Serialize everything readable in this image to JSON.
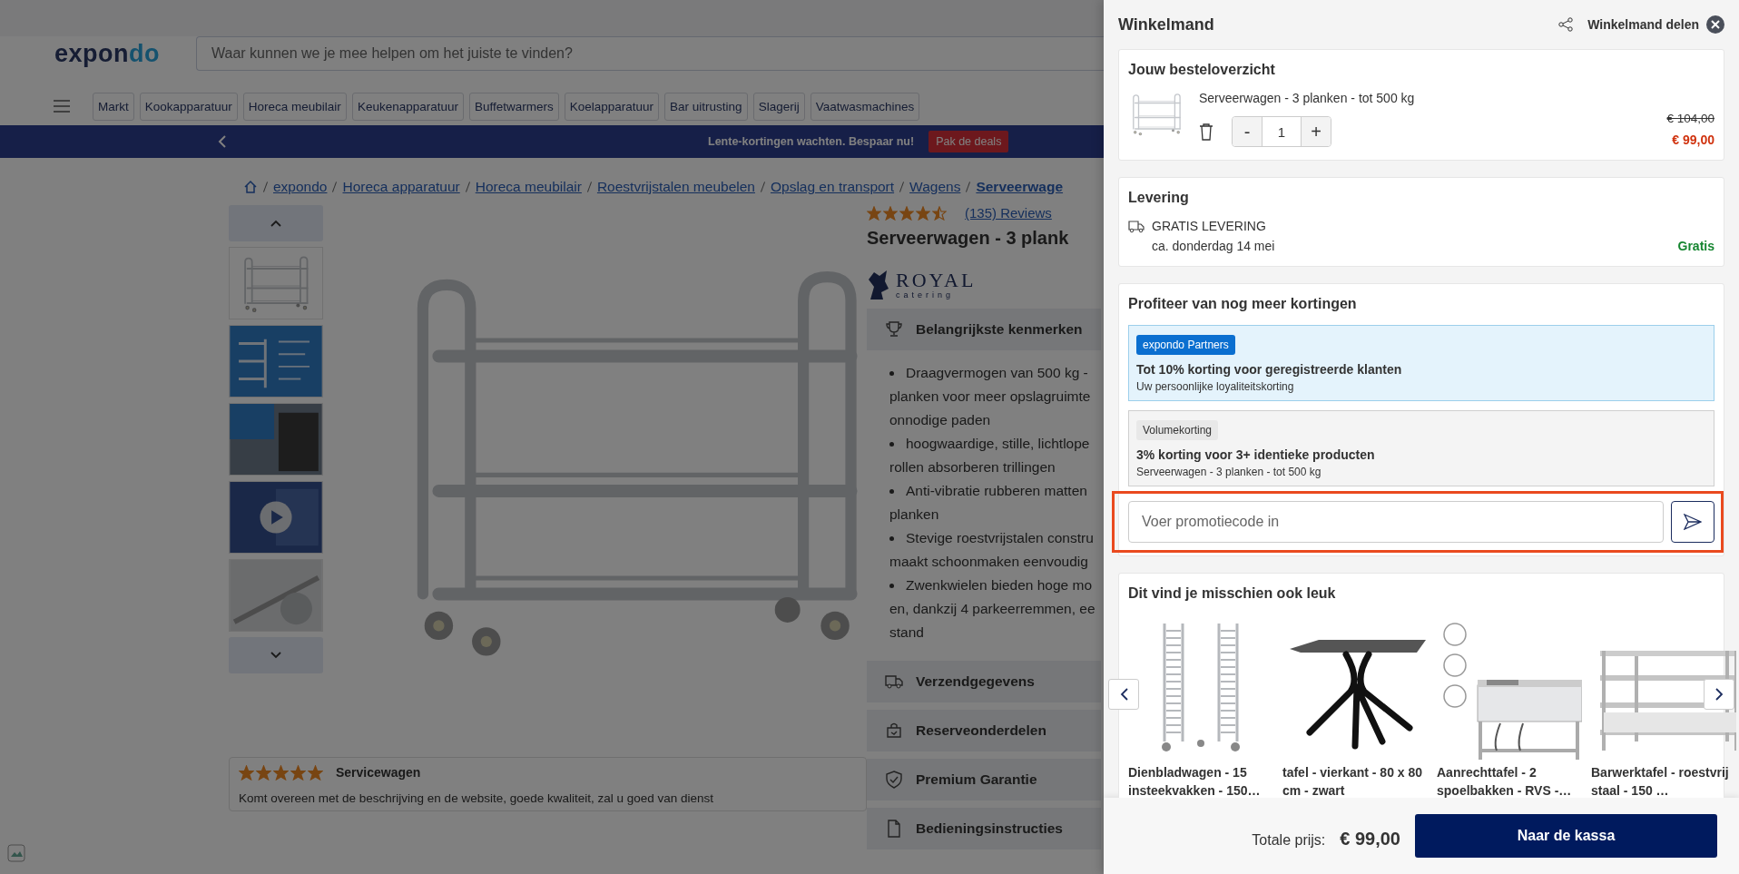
{
  "site": {
    "logo": {
      "dark": "expon",
      "accent": "do"
    },
    "search": {
      "placeholder": "Waar kunnen we je mee helpen om het juiste te vinden?"
    },
    "categories": [
      "Markt",
      "Kookapparatuur",
      "Horeca meubilair",
      "Keukenapparatuur",
      "Buffetwarmers",
      "Koelapparatuur",
      "Bar uitrusting",
      "Slagerij",
      "Vaatwasmachines"
    ],
    "banner": {
      "text": "Lente-kortingen wachten. Bespaar nu!",
      "button": "Pak de deals"
    },
    "breadcrumb": [
      "expondo",
      "Horeca apparatuur",
      "Horeca meubilair",
      "Roestvrijstalen meubelen",
      "Opslag en transport",
      "Wagens",
      "Serveerwage"
    ],
    "thumbnails": [
      {
        "kind": "product"
      },
      {
        "kind": "infographic"
      },
      {
        "kind": "photo"
      },
      {
        "kind": "video"
      },
      {
        "kind": "detail"
      }
    ],
    "product": {
      "stars": 4.5,
      "reviews": "(135) Reviews",
      "title": "Serveerwagen - 3 plank",
      "brand": {
        "name": "ROYAL",
        "sub": "catering"
      },
      "features_title": "Belangrijkste kenmerken",
      "features": [
        [
          "Draagvermogen van 500 kg -",
          "planken voor meer opslagruimte",
          "onnodige paden"
        ],
        [
          "hoogwaardige, stille, lichtlope",
          "rollen absorberen trillingen"
        ],
        [
          "Anti-vibratie rubberen matten",
          "planken"
        ],
        [
          "Stevige roestvrijstalen constru",
          "maakt schoonmaken eenvoudig"
        ],
        [
          "Zwenkwielen bieden hoge mo",
          "en, dankzij 4 parkeerremmen, ee",
          "stand"
        ]
      ],
      "sections": [
        {
          "kind": "truck",
          "title": "Verzendgegevens"
        },
        {
          "kind": "parts",
          "title": "Reserveonderdelen"
        },
        {
          "kind": "shield",
          "title": "Premium Garantie"
        },
        {
          "kind": "document",
          "title": "Bedieningsinstructies"
        }
      ]
    },
    "review": {
      "stars": 5,
      "title": "Servicewagen",
      "text": "Komt overeen met de beschrijving en de website, goede kwaliteit, zal u goed van dienst"
    }
  },
  "cart": {
    "title": "Winkelmand",
    "share": "Winkelmand delen",
    "order": {
      "title": "Jouw besteloverzicht",
      "items": [
        {
          "name": "Serveerwagen - 3 planken - tot 500 kg",
          "minus": "-",
          "quantity": "1",
          "plus": "+",
          "old_price": "€ 104,00",
          "price": "€ 99,00"
        }
      ]
    },
    "delivery": {
      "title": "Levering",
      "method": "GRATIS LEVERING",
      "date": "ca. donderdag 14 mei",
      "cost": "Gratis"
    },
    "discounts": {
      "title": "Profiteer van nog meer kortingen",
      "offers": [
        {
          "kind": "partner",
          "tag": "expondo Partners",
          "headline": "Tot 10% korting voor geregistreerde klanten",
          "detail": "Uw persoonlijke loyaliteitskorting"
        },
        {
          "kind": "volume",
          "tag": "Volumekorting",
          "headline": "3% korting voor 3+ identieke producten",
          "detail": "Serveerwagen - 3 planken - tot 500 kg"
        }
      ],
      "promo": {
        "placeholder": "Voer promotiecode in"
      }
    },
    "recommendations": {
      "title": "Dit vind je misschien ook leuk",
      "items": [
        {
          "kind": "rack",
          "name": "Dienbladwagen - 15 insteekvakken - 150…"
        },
        {
          "kind": "table",
          "name": "tafel - vierkant - 80 x 80 cm - zwart"
        },
        {
          "kind": "sink",
          "name": "Aanrechttafel - 2 spoelbakken - RVS -…"
        },
        {
          "kind": "worktable",
          "name": "Barwerktafel - roestvrij staal - 150 …"
        }
      ]
    },
    "footer": {
      "total_label": "Totale prijs:",
      "total": "€ 99,00",
      "checkout": "Naar de kassa"
    }
  }
}
